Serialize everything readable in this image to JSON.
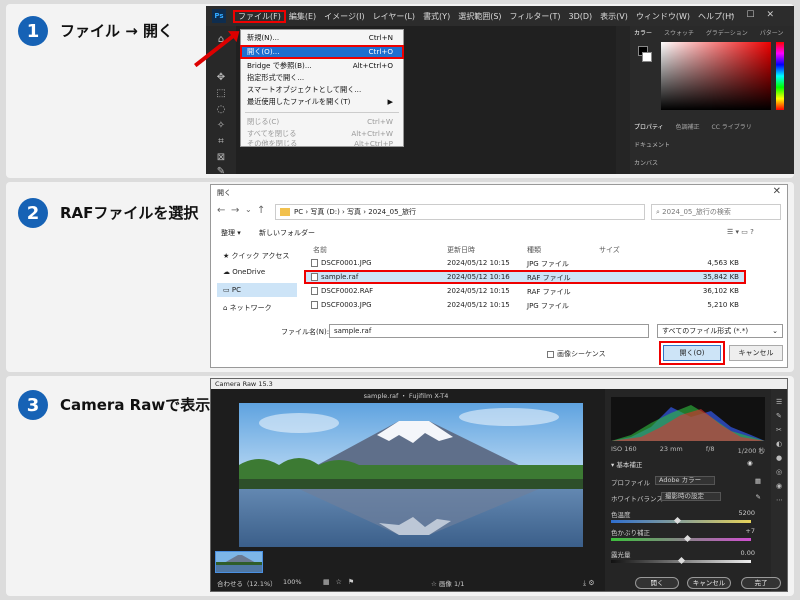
{
  "steps": [
    {
      "number": "1",
      "title": "ファイル → 開く"
    },
    {
      "number": "2",
      "title": "RAFファイルを選択"
    },
    {
      "number": "3",
      "title": "Camera Rawで表示"
    }
  ],
  "ps": {
    "logo": "Ps",
    "menus": [
      "ファイル(F)",
      "編集(E)",
      "イメージ(I)",
      "レイヤー(L)",
      "書式(Y)",
      "選択範囲(S)",
      "フィルター(T)",
      "3D(D)",
      "表示(V)",
      "ウィンドウ(W)",
      "ヘルプ(H)"
    ],
    "file_menu": [
      {
        "label": "新規(N)...",
        "shortcut": "Ctrl+N"
      },
      {
        "label": "開く(O)...",
        "shortcut": "Ctrl+O"
      },
      {
        "label": "Bridge で参照(B)...",
        "shortcut": "Alt+Ctrl+O"
      },
      {
        "label": "指定形式で開く...",
        "shortcut": ""
      },
      {
        "label": "スマートオブジェクトとして開く...",
        "shortcut": ""
      },
      {
        "label": "最近使用したファイルを開く(T)",
        "shortcut": "▶"
      },
      {
        "label": "閉じる(C)",
        "shortcut": "Ctrl+W"
      },
      {
        "label": "すべてを閉じる",
        "shortcut": "Alt+Ctrl+W"
      },
      {
        "label": "その他を閉じる",
        "shortcut": "Alt+Ctrl+P"
      }
    ],
    "panel_tabs": [
      "カラー",
      "スウォッチ",
      "グラデーション",
      "パターン"
    ],
    "panel_tabs2": [
      "プロパティ",
      "色調補正",
      "CC ライブラリ"
    ],
    "doc_label": "ドキュメント",
    "canvas_label": "カンバス"
  },
  "dialog": {
    "title": "開く",
    "path": [
      "PC",
      "写真 (D:)",
      "写真",
      "2024_05_旅行"
    ],
    "search_placeholder": "2024_05_旅行の検索",
    "organize": "整理 ▾",
    "new_folder": "新しいフォルダー",
    "sidebar": [
      "クイック アクセス",
      "OneDrive",
      "PC",
      "ネットワーク"
    ],
    "columns": [
      "名前",
      "更新日時",
      "種類",
      "サイズ"
    ],
    "files": [
      {
        "name": "DSCF0001.JPG",
        "date": "2024/05/12 10:15",
        "type": "JPG ファイル",
        "size": "4,563 KB"
      },
      {
        "name": "sample.raf",
        "date": "2024/05/12 10:16",
        "type": "RAF ファイル",
        "size": "35,842 KB"
      },
      {
        "name": "DSCF0002.RAF",
        "date": "2024/05/12 10:15",
        "type": "RAF ファイル",
        "size": "36,102 KB"
      },
      {
        "name": "DSCF0003.JPG",
        "date": "2024/05/12 10:15",
        "type": "JPG ファイル",
        "size": "5,210 KB"
      }
    ],
    "filename_label": "ファイル名(N):",
    "filename_value": "sample.raf",
    "filetype": "すべてのファイル形式 (*.*)",
    "image_sequence": "画像シーケンス",
    "open_button": "開く(O)",
    "cancel_button": "キャンセル"
  },
  "camera_raw": {
    "title": "Camera Raw 15.3",
    "filename": "sample.raf ・ Fujifilm X-T4",
    "exif": [
      "ISO 160",
      "23 mm",
      "f/8",
      "1/200 秒"
    ],
    "section": "基本補正",
    "profile_label": "プロファイル",
    "profile_value": "Adobe カラー",
    "wb_label": "ホワイトバランス",
    "wb_value": "撮影時の設定",
    "temp_label": "色温度",
    "temp_value": "5200",
    "tint_label": "色かぶり補正",
    "tint_value": "+7",
    "exposure_label": "露光量",
    "exposure_value": "0.00",
    "zoom_label": "合わせる（12.1%）",
    "zoom_pct": "100%",
    "image_count": "画像 1/1",
    "open_button": "開く",
    "cancel_button": "キャンセル",
    "done_button": "完了"
  }
}
